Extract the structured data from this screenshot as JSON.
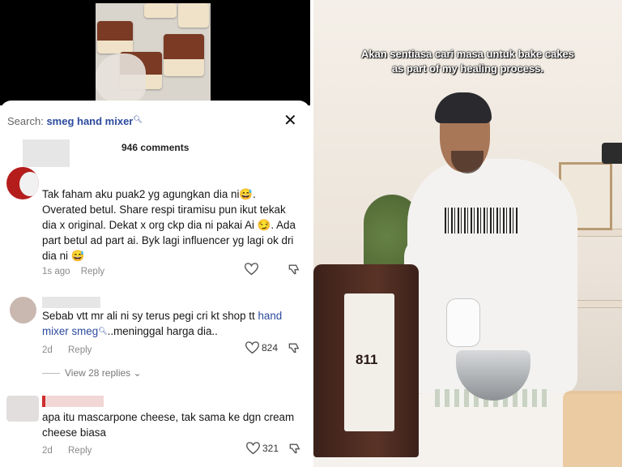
{
  "left_panel": {
    "search": {
      "label": "Search:",
      "query": "smeg hand mixer"
    },
    "comment_count": "946 comments",
    "comments": [
      {
        "text": "Tak faham aku puak2 yg agungkan dia ni😅. Overated betul. Share respi tiramisu pun ikut tekak dia x original. Dekat x org ckp dia ni pakai Ai 😏. Ada part betul ad part ai. Byk lagi influencer yg lagi ok dri dia ni 😅",
        "time": "1s ago",
        "reply": "Reply",
        "likes": ""
      },
      {
        "text_before_link": "Sebab vtt mr ali ni sy terus pegi cri kt shop tt ",
        "link": "hand mixer smeg",
        "text_after_link": "..meninggal harga dia..",
        "time": "2d",
        "reply": "Reply",
        "likes": "824",
        "view_replies": "View 28 replies"
      },
      {
        "text": "apa itu mascarpone cheese, tak sama ke dgn cream cheese biasa",
        "time": "2d",
        "reply": "Reply",
        "likes": "321"
      }
    ]
  },
  "right_panel": {
    "caption_line1": "Akan sentiasa cari masa untuk bake cakes",
    "caption_line2": "as part of my healing process.",
    "bag_number": "811"
  },
  "colors": {
    "link": "#2c4a9e",
    "text": "#161616",
    "meta": "#8a8a8a"
  },
  "icons": [
    "search-icon",
    "close-icon",
    "heart-icon",
    "dislike-icon",
    "chevron-down-icon"
  ]
}
